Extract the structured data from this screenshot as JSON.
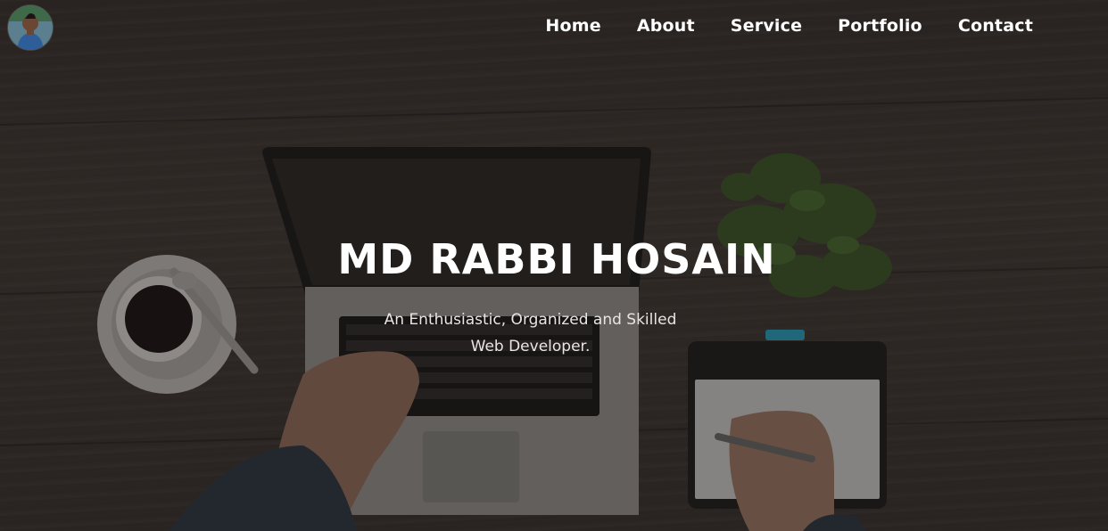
{
  "nav": {
    "items": [
      {
        "label": "Home"
      },
      {
        "label": "About"
      },
      {
        "label": "Service"
      },
      {
        "label": "Portfolio"
      },
      {
        "label": "Contact"
      }
    ]
  },
  "hero": {
    "title": "MD RABBI HOSAIN",
    "subtitle": "An Enthusiastic, Organized and Skilled Web Developer."
  },
  "colors": {
    "text": "#ffffff",
    "subtitle_text": "#e9e5e2",
    "background": "#3b3431"
  },
  "icons": {
    "avatar": "profile-photo"
  }
}
